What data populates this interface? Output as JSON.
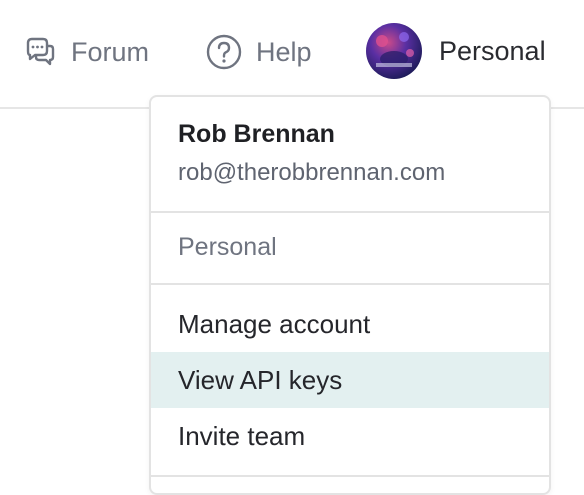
{
  "topbar": {
    "forum_label": "Forum",
    "help_label": "Help",
    "account_label": "Personal"
  },
  "icons": {
    "forum": "chat-bubbles-icon",
    "help": "question-circle-icon",
    "avatar": "user-avatar"
  },
  "dropdown": {
    "user_name": "Rob Brennan",
    "user_email": "rob@therobbrennan.com",
    "workspace": "Personal",
    "items": [
      {
        "label": "Manage account"
      },
      {
        "label": "View API keys"
      },
      {
        "label": "Invite team"
      }
    ],
    "highlighted_item": "View API keys"
  },
  "colors": {
    "highlight": "#e3f0f0",
    "muted_text": "#6f7480",
    "border": "#e3e3e3"
  }
}
